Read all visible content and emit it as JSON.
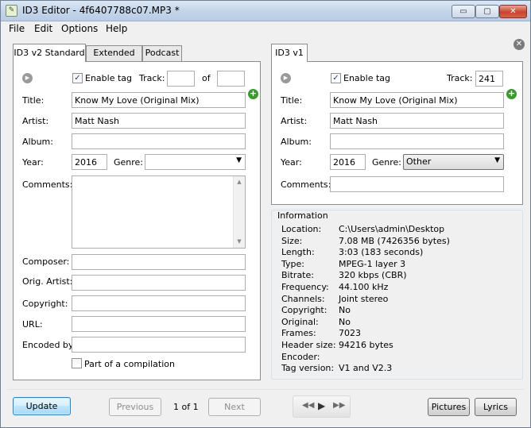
{
  "window": {
    "title": "ID3 Editor - 4f6407788c07.MP3 *",
    "controls": {
      "min": "▭",
      "max": "▢",
      "close": "✕"
    }
  },
  "menu": [
    "File",
    "Edit",
    "Options",
    "Help"
  ],
  "v2": {
    "tabs": [
      "ID3 v2 Standard",
      "Extended",
      "Podcast"
    ],
    "enable_label": "Enable tag",
    "track_label": "Track:",
    "track_value": "",
    "of_label": "of",
    "of_value": "",
    "title_label": "Title:",
    "title_value": "Know My Love (Original Mix)",
    "artist_label": "Artist:",
    "artist_value": "Matt Nash",
    "album_label": "Album:",
    "album_value": "",
    "year_label": "Year:",
    "year_value": "2016",
    "genre_label": "Genre:",
    "genre_value": "",
    "comments_label": "Comments:",
    "comments_value": "",
    "composer_label": "Composer:",
    "composer_value": "",
    "orig_artist_label": "Orig. Artist:",
    "orig_artist_value": "",
    "copyright_label": "Copyright:",
    "copyright_value": "",
    "url_label": "URL:",
    "url_value": "",
    "encoded_label": "Encoded by:",
    "encoded_value": "",
    "compilation_label": "Part of a compilation"
  },
  "v1": {
    "tab": "ID3 v1",
    "enable_label": "Enable tag",
    "track_label": "Track:",
    "track_value": "241",
    "title_label": "Title:",
    "title_value": "Know My Love (Original Mix)",
    "artist_label": "Artist:",
    "artist_value": "Matt Nash",
    "album_label": "Album:",
    "album_value": "",
    "year_label": "Year:",
    "year_value": "2016",
    "genre_label": "Genre:",
    "genre_value": "Other",
    "comments_label": "Comments:",
    "comments_value": ""
  },
  "info": {
    "title": "Information",
    "rows": [
      {
        "key": "Location:",
        "value": "C:\\Users\\admin\\Desktop"
      },
      {
        "key": "Size:",
        "value": "7.08 MB (7426356 bytes)"
      },
      {
        "key": "Length:",
        "value": "3:03 (183 seconds)"
      },
      {
        "key": "Type:",
        "value": "MPEG-1 layer 3"
      },
      {
        "key": "Bitrate:",
        "value": "320 kbps (CBR)"
      },
      {
        "key": "Frequency:",
        "value": "44.100 kHz"
      },
      {
        "key": "Channels:",
        "value": "Joint stereo"
      },
      {
        "key": "Copyright:",
        "value": "No"
      },
      {
        "key": "Original:",
        "value": "No"
      },
      {
        "key": "Frames:",
        "value": "7023"
      },
      {
        "key": "Header size:",
        "value": "94216 bytes"
      },
      {
        "key": "Encoder:",
        "value": ""
      },
      {
        "key": "Tag version:",
        "value": "V1 and V2.3"
      }
    ]
  },
  "footer": {
    "update": "Update",
    "previous": "Previous",
    "page": "1 of 1",
    "next": "Next",
    "pictures": "Pictures",
    "lyrics": "Lyrics"
  },
  "icons": {
    "app": "✎",
    "dismiss": "✕",
    "play": "▶",
    "plus": "+",
    "checkmark": "✓",
    "dropdown": "▼",
    "scroll_up": "▲",
    "scroll_down": "▼",
    "rewind": "◀◀",
    "player_play": "▶",
    "forward": "▶▶"
  }
}
